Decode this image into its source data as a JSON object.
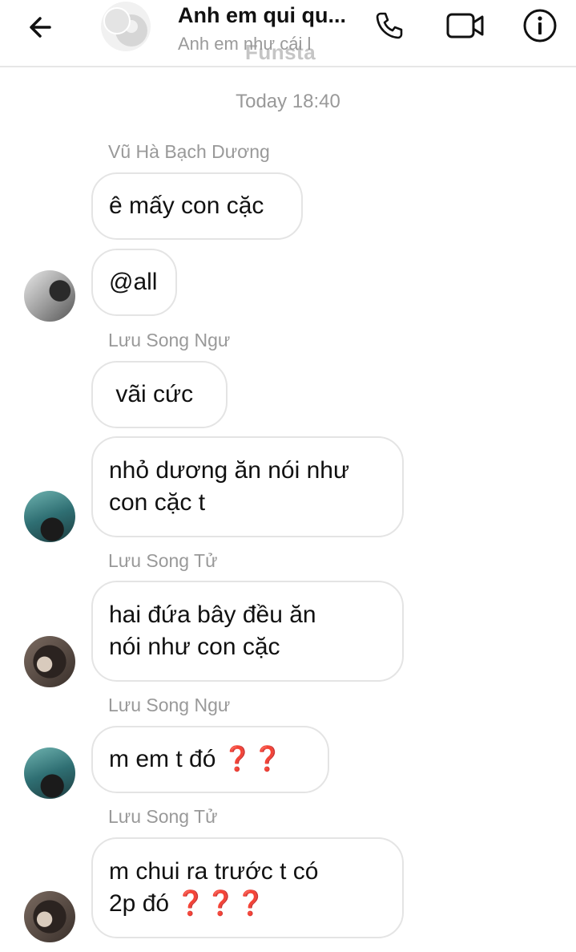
{
  "header": {
    "title": "Anh em qui qu...",
    "subtitle": "Anh em như cái l",
    "watermark": "Funsta"
  },
  "timestamp": "Today 18:40",
  "messages": [
    {
      "sender": "Vũ Hà Bạch Dương",
      "lines": [
        "ê mấy con cặc"
      ]
    },
    {
      "sender": "",
      "lines": [
        "@all"
      ]
    },
    {
      "sender": "Lưu Song Ngư",
      "lines": [
        " vãi cức"
      ]
    },
    {
      "sender": "",
      "lines": [
        "nhỏ dương ăn nói như",
        "con cặc t"
      ]
    },
    {
      "sender": "Lưu Song Tử",
      "lines": [
        "hai đứa bây đều ăn",
        "nói như con cặc"
      ]
    },
    {
      "sender": "Lưu Song Ngư",
      "lines": [
        "m em t đó ",
        "❓❓"
      ]
    },
    {
      "sender": "Lưu Song Tử",
      "lines": [
        "m chui ra trước t có",
        "2p đó ",
        "❓❓❓"
      ]
    }
  ],
  "icons": {
    "back": "arrow-left-icon",
    "call": "phone-icon",
    "video": "video-camera-icon",
    "info": "info-icon"
  }
}
